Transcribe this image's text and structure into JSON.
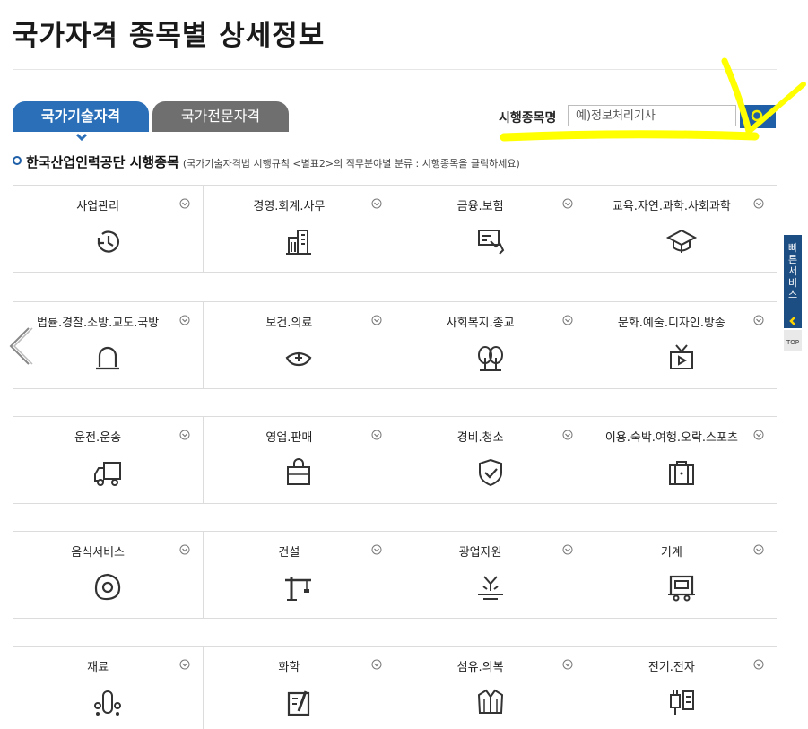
{
  "page": {
    "title": "국가자격 종목별 상세정보"
  },
  "tabs": [
    {
      "label": "국가기술자격",
      "active": true
    },
    {
      "label": "국가전문자격",
      "active": false
    }
  ],
  "search": {
    "label": "시행종목명",
    "placeholder": "예)정보처리기사",
    "button_icon": "search-icon"
  },
  "section": {
    "title": "한국산업인력공단 시행종목",
    "subtitle": "(국가기술자격법 시행규칙 <별표2>의 직무분야별 분류 : 시행종목을 클릭하세요)"
  },
  "categories": [
    [
      {
        "name": "사업관리",
        "icon": "clock-rotate-icon"
      },
      {
        "name": "경영.회계.사무",
        "icon": "building-icon"
      },
      {
        "name": "금융.보험",
        "icon": "card-hand-icon"
      },
      {
        "name": "교육.자연.과학.사회과학",
        "icon": "graduation-cap-icon"
      }
    ],
    [
      {
        "name": "법률.경찰.소방.교도.국방",
        "icon": "siren-icon"
      },
      {
        "name": "보건.의료",
        "icon": "nurse-cap-icon"
      },
      {
        "name": "사회복지.종교",
        "icon": "trees-icon"
      },
      {
        "name": "문화.예술.디자인.방송",
        "icon": "tv-icon"
      }
    ],
    [
      {
        "name": "운전.운송",
        "icon": "truck-icon"
      },
      {
        "name": "영업.판매",
        "icon": "shopping-bag-icon"
      },
      {
        "name": "경비.청소",
        "icon": "shield-check-icon"
      },
      {
        "name": "이용.숙박.여행.오락.스포츠",
        "icon": "suitcase-icon"
      }
    ],
    [
      {
        "name": "음식서비스",
        "icon": "fried-egg-icon"
      },
      {
        "name": "건설",
        "icon": "crane-icon"
      },
      {
        "name": "광업자원",
        "icon": "mining-icon"
      },
      {
        "name": "기계",
        "icon": "machine-icon"
      }
    ],
    [
      {
        "name": "재료",
        "icon": "molecule-icon"
      },
      {
        "name": "화학",
        "icon": "beaker-board-icon"
      },
      {
        "name": "섬유.의복",
        "icon": "jacket-icon"
      },
      {
        "name": "전기.전자",
        "icon": "plug-icon"
      }
    ]
  ],
  "side": {
    "quick_service": "빠른서비스",
    "top": "TOP"
  },
  "colors": {
    "tab_active": "#2a6fb8",
    "tab_inactive": "#6f6f6f",
    "search_button": "#1e5fa8",
    "highlight": "#ffff00"
  }
}
